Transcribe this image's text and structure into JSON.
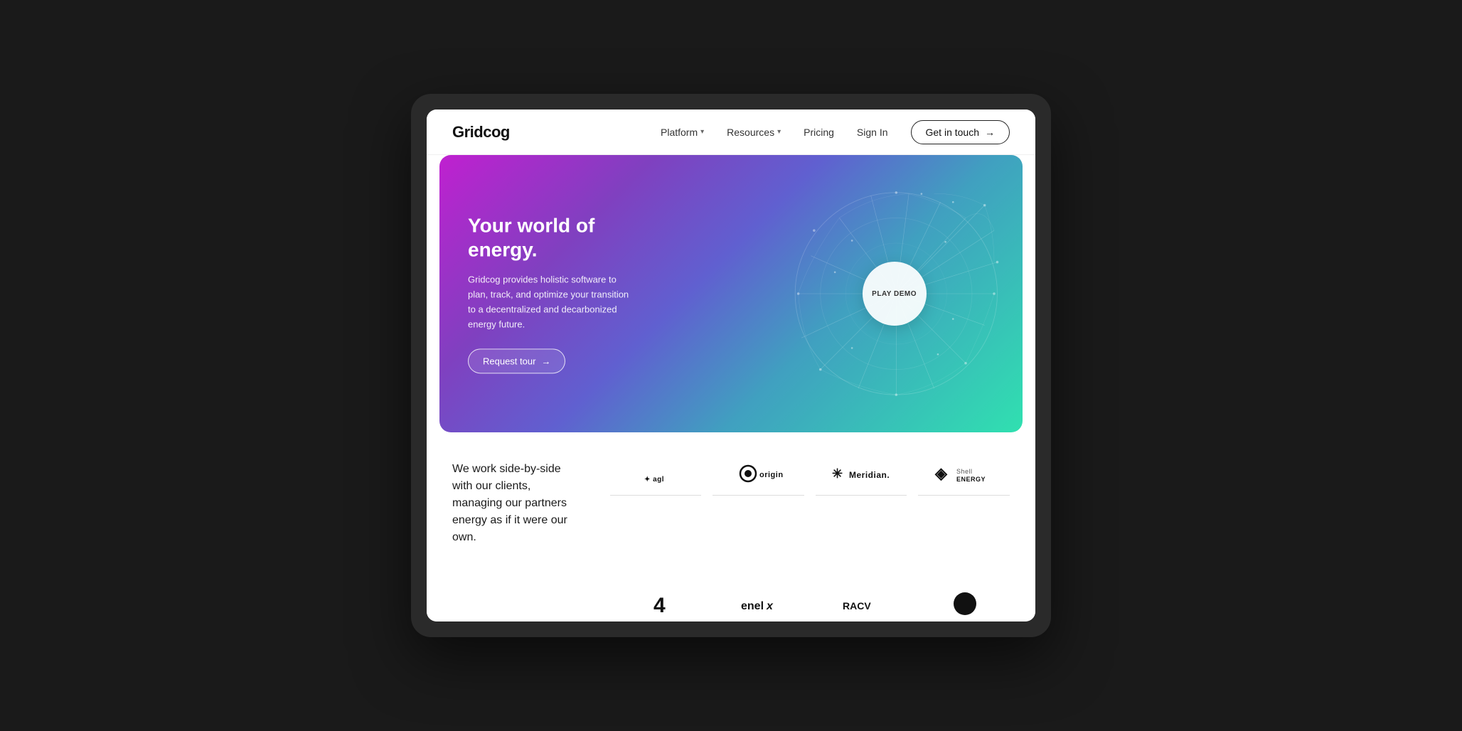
{
  "device": {
    "background": "#1a1a1a"
  },
  "navbar": {
    "logo": "Gridcog",
    "links": [
      {
        "id": "platform",
        "label": "Platform",
        "hasDropdown": true
      },
      {
        "id": "resources",
        "label": "Resources",
        "hasDropdown": true
      },
      {
        "id": "pricing",
        "label": "Pricing",
        "hasDropdown": false
      },
      {
        "id": "signin",
        "label": "Sign In",
        "hasDropdown": false
      }
    ],
    "cta_label": "Get in touch",
    "cta_arrow": "→"
  },
  "hero": {
    "title": "Your world of energy.",
    "description": "Gridcog provides holistic software to plan, track, and optimize your transition to a decentralized and decarbonized energy future.",
    "cta_label": "Request tour",
    "cta_arrow": "→",
    "play_demo_label": "PLAY DEMO"
  },
  "clients": {
    "text_line1": "We work side-by-side",
    "text_line2": "with our clients,",
    "text_line3": "managing our partners",
    "text_line4": "energy as if it were our",
    "text_line5": "own.",
    "logos_row1": [
      {
        "id": "agl",
        "label": "agl",
        "symbol": "✦"
      },
      {
        "id": "origin",
        "label": "origin",
        "symbol": "◉"
      },
      {
        "id": "meridian",
        "label": "Meridian.",
        "symbol": "✳"
      },
      {
        "id": "shell-energy",
        "label": "Shell ENERGY",
        "symbol": "◈"
      }
    ],
    "logos_row2": [
      {
        "id": "logo5",
        "label": "4",
        "symbol": "4"
      },
      {
        "id": "logo6",
        "label": "enelx",
        "symbol": "enelx"
      },
      {
        "id": "logo7",
        "label": "RACV",
        "symbol": "RACV"
      },
      {
        "id": "logo8",
        "label": "•••",
        "symbol": "●"
      }
    ]
  }
}
